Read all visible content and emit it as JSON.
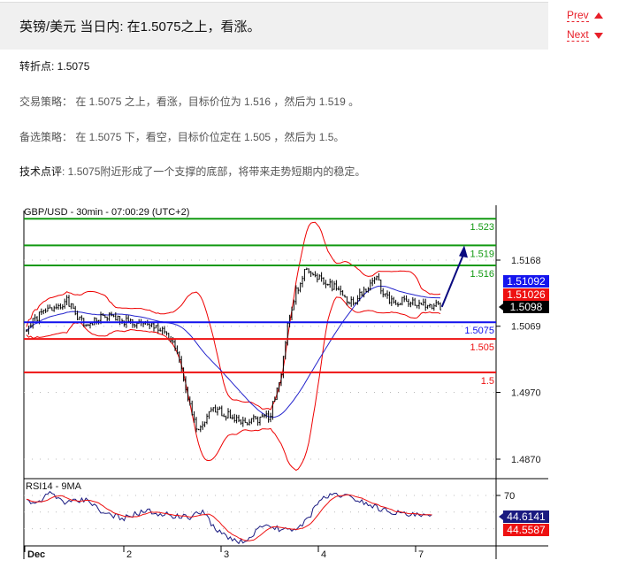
{
  "header": {
    "title": "英镑/美元 当日内: 在1.5075之上，看涨。",
    "prev": "Prev",
    "next": "Next"
  },
  "pivot": {
    "label": "转折点",
    "value": ": 1.5075"
  },
  "strategy": {
    "label": "交易策略：",
    "text": " 在 1.5075 之上，看涨，目标价位为 1.516 ，然后为 1.519 。"
  },
  "alternative": {
    "label": "备选策略：",
    "text": " 在 1.5075 下，看空，目标价位定在 1.505 ，然后为 1.5。"
  },
  "comment": {
    "label": "技术点评",
    "text": ": 1.5075附近形成了一个支撑的底部，将带来走势短期内的稳定。"
  },
  "chart_data": {
    "type": "candlestick",
    "title": "GBP/USD - 30min - 07:00:29 (UTC+2)",
    "x_ticks": [
      "Dec",
      "2",
      "3",
      "4",
      "7"
    ],
    "y_ticks": [
      "1.5168",
      "1.5069",
      "1.4970",
      "1.4870"
    ],
    "ylim": [
      1.4845,
      1.5245
    ],
    "levels": [
      {
        "value": 1.523,
        "label": "1.523",
        "color": "#119911"
      },
      {
        "value": 1.519,
        "label": "1.519",
        "color": "#119911"
      },
      {
        "value": 1.516,
        "label": "1.516",
        "color": "#119911"
      },
      {
        "value": 1.5075,
        "label": "1.5075",
        "color": "#1010ee"
      },
      {
        "value": 1.505,
        "label": "1.505",
        "color": "#ee1111"
      },
      {
        "value": 1.5,
        "label": "1.5",
        "color": "#ee1111"
      }
    ],
    "price_path": [
      [
        0,
        1.5065
      ],
      [
        0.14,
        1.5087
      ],
      [
        0.41,
        1.5107
      ],
      [
        0.59,
        1.507
      ],
      [
        0.82,
        1.5085
      ],
      [
        1.09,
        1.5074
      ],
      [
        1.41,
        1.5065
      ],
      [
        1.55,
        1.5028
      ],
      [
        1.68,
        1.4948
      ],
      [
        1.77,
        1.4908
      ],
      [
        1.91,
        1.4945
      ],
      [
        2.09,
        1.4935
      ],
      [
        2.27,
        1.4927
      ],
      [
        2.5,
        1.4935
      ],
      [
        2.62,
        1.5001
      ],
      [
        2.68,
        1.5067
      ],
      [
        2.77,
        1.512
      ],
      [
        2.86,
        1.5153
      ],
      [
        3,
        1.514
      ],
      [
        3.18,
        1.5127
      ],
      [
        3.36,
        1.51
      ],
      [
        3.45,
        1.512
      ],
      [
        3.59,
        1.514
      ],
      [
        3.73,
        1.5107
      ],
      [
        3.91,
        1.5107
      ],
      [
        4.09,
        1.51
      ],
      [
        4.27,
        1.5098
      ]
    ],
    "projection": [
      [
        4.27,
        1.5098
      ],
      [
        4.5,
        1.519
      ]
    ],
    "badges": {
      "upper": "1.51092",
      "lower": "1.51026",
      "last": "1.5098"
    },
    "rsi": {
      "label": "RSI14 - 9MA",
      "tick": "70",
      "value": "44.6141",
      "ma": "44.5587",
      "path": [
        [
          0,
          65
        ],
        [
          0.14,
          60
        ],
        [
          0.23,
          73
        ],
        [
          0.41,
          61
        ],
        [
          0.64,
          65
        ],
        [
          0.77,
          49
        ],
        [
          1,
          43
        ],
        [
          1.23,
          51
        ],
        [
          1.55,
          45
        ],
        [
          1.68,
          43
        ],
        [
          1.82,
          52
        ],
        [
          1.95,
          27
        ],
        [
          2.14,
          16
        ],
        [
          2.27,
          13
        ],
        [
          2.36,
          29
        ],
        [
          2.5,
          32
        ],
        [
          2.73,
          27
        ],
        [
          2.91,
          43
        ],
        [
          3,
          64
        ],
        [
          3.18,
          72
        ],
        [
          3.36,
          67
        ],
        [
          3.64,
          54
        ],
        [
          3.91,
          47
        ],
        [
          4.18,
          44.6
        ]
      ]
    }
  },
  "colors": {
    "accent": "#e8202a",
    "band": "#ee0000",
    "ma": "#2222cc",
    "arrow": "#0a0a80"
  }
}
